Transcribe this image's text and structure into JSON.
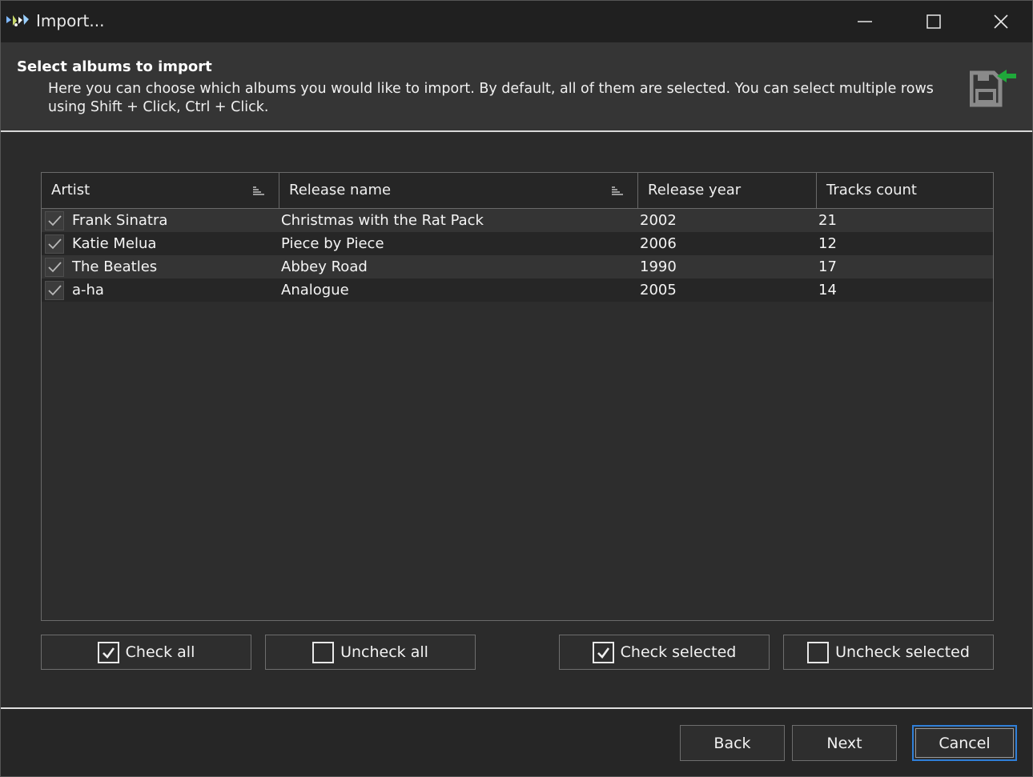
{
  "window": {
    "title": "Import..."
  },
  "banner": {
    "title": "Select albums to import",
    "description": "Here you can choose which albums you would like to import. By default, all of them are selected. You can select multiple rows using Shift + Click, Ctrl + Click."
  },
  "grid": {
    "columns": [
      "Artist",
      "Release name",
      "Release year",
      "Tracks count"
    ],
    "rows": [
      {
        "checked": true,
        "artist": "Frank Sinatra",
        "release": "Christmas with the Rat Pack",
        "year": "2002",
        "tracks": "21"
      },
      {
        "checked": true,
        "artist": "Katie Melua",
        "release": "Piece by Piece",
        "year": "2006",
        "tracks": "12"
      },
      {
        "checked": true,
        "artist": "The Beatles",
        "release": "Abbey Road",
        "year": "1990",
        "tracks": "17"
      },
      {
        "checked": true,
        "artist": "a-ha",
        "release": "Analogue",
        "year": "2005",
        "tracks": "14"
      }
    ]
  },
  "actions": {
    "check_all": "Check all",
    "uncheck_all": "Uncheck all",
    "check_selected": "Check selected",
    "uncheck_selected": "Uncheck selected"
  },
  "footer": {
    "back": "Back",
    "next": "Next",
    "cancel": "Cancel"
  },
  "colors": {
    "accent_focus": "#2f7fd8",
    "import_arrow": "#1fa83a"
  }
}
